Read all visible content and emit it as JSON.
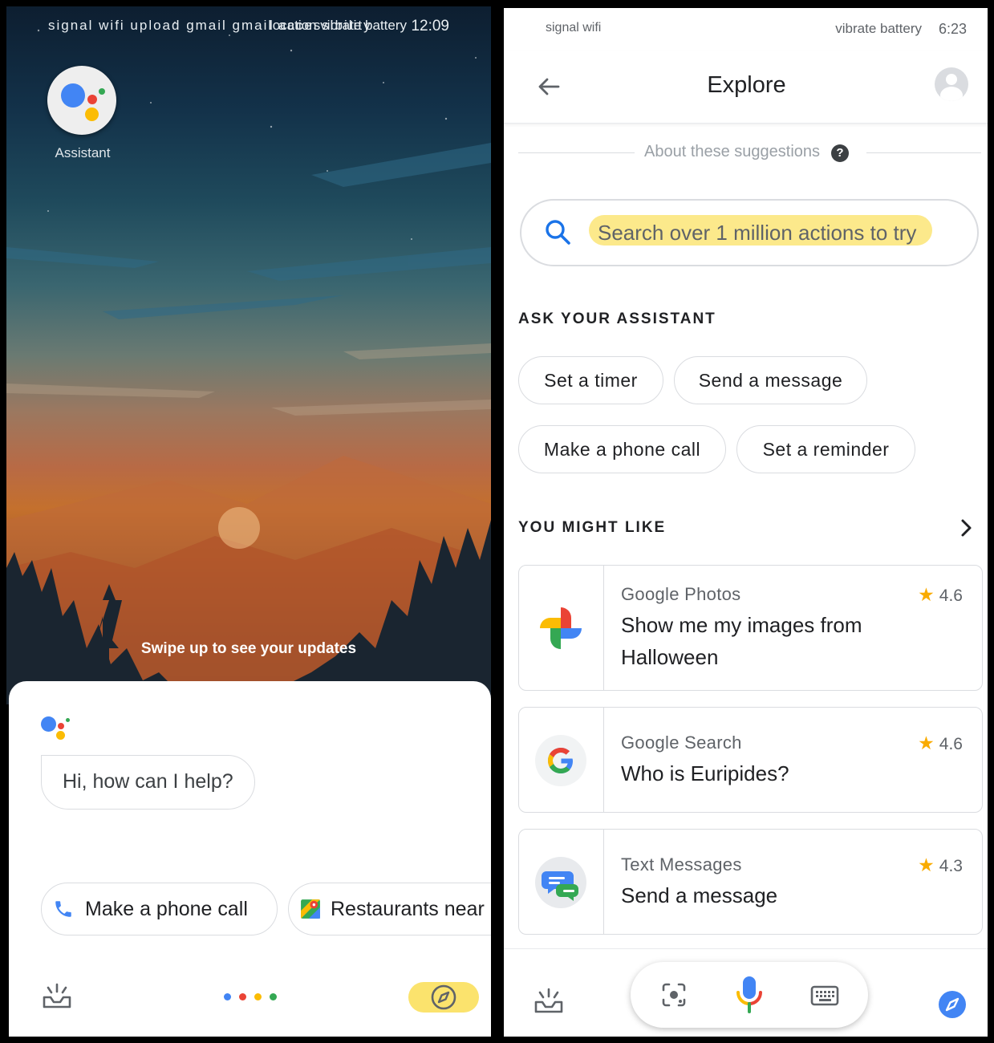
{
  "left_screen": {
    "status_bar": {
      "left_icons": "signal wifi upload gmail gmail accessibility",
      "right_icons": "location vibrate battery",
      "time": "12:09"
    },
    "app_icon": {
      "icon": "google-assistant-icon",
      "label": "Assistant"
    },
    "swipe_hint": "Swipe up to see your updates",
    "assistant_prompt": "Hi, how can I help?",
    "suggestion_chips": [
      {
        "label": "Make a phone call",
        "icon": "phone-icon"
      },
      {
        "label": "Restaurants near",
        "icon": "google-maps-icon"
      }
    ],
    "bottom_bar": {
      "left_icon": "updates-tray-icon",
      "center_icon": "assistant-dots-icon",
      "right_icon": "compass-icon"
    }
  },
  "right_screen": {
    "status_bar": {
      "left_icons": "signal wifi",
      "right_icons": "vibrate battery",
      "time": "6:23"
    },
    "header": {
      "title": "Explore",
      "back_icon": "back-arrow-icon",
      "avatar_icon": "account-avatar-icon"
    },
    "about_suggestions": "About these suggestions",
    "search": {
      "placeholder": "Search over 1 million actions to try",
      "icon": "search-icon"
    },
    "ask_section": {
      "title": "ASK YOUR ASSISTANT",
      "chips": [
        "Set a timer",
        "Send a message",
        "Make a phone call",
        "Set a reminder"
      ]
    },
    "might_like": {
      "title": "YOU MIGHT LIKE",
      "cards": [
        {
          "app": "Google Photos",
          "query": "Show me my images from Halloween",
          "rating": "4.6",
          "icon": "google-photos-icon"
        },
        {
          "app": "Google Search",
          "query": "Who is Euripides?",
          "rating": "4.6",
          "icon": "google-g-icon"
        },
        {
          "app": "Text Messages",
          "query": "Send a message",
          "rating": "4.3",
          "icon": "messages-icon"
        }
      ]
    },
    "bottom_bar": {
      "left_icon": "updates-tray-icon",
      "lens_icon": "lens-icon",
      "mic_icon": "microphone-icon",
      "keyboard_icon": "keyboard-icon",
      "right_icon": "compass-icon"
    }
  },
  "colors": {
    "google_blue": "#4285F4",
    "google_red": "#EA4335",
    "google_yellow": "#FBBC04",
    "google_green": "#34A853",
    "highlight_yellow": "#FCE98B",
    "chip_border": "#DADCE0",
    "text_primary": "#202124",
    "text_secondary": "#5F6368"
  }
}
